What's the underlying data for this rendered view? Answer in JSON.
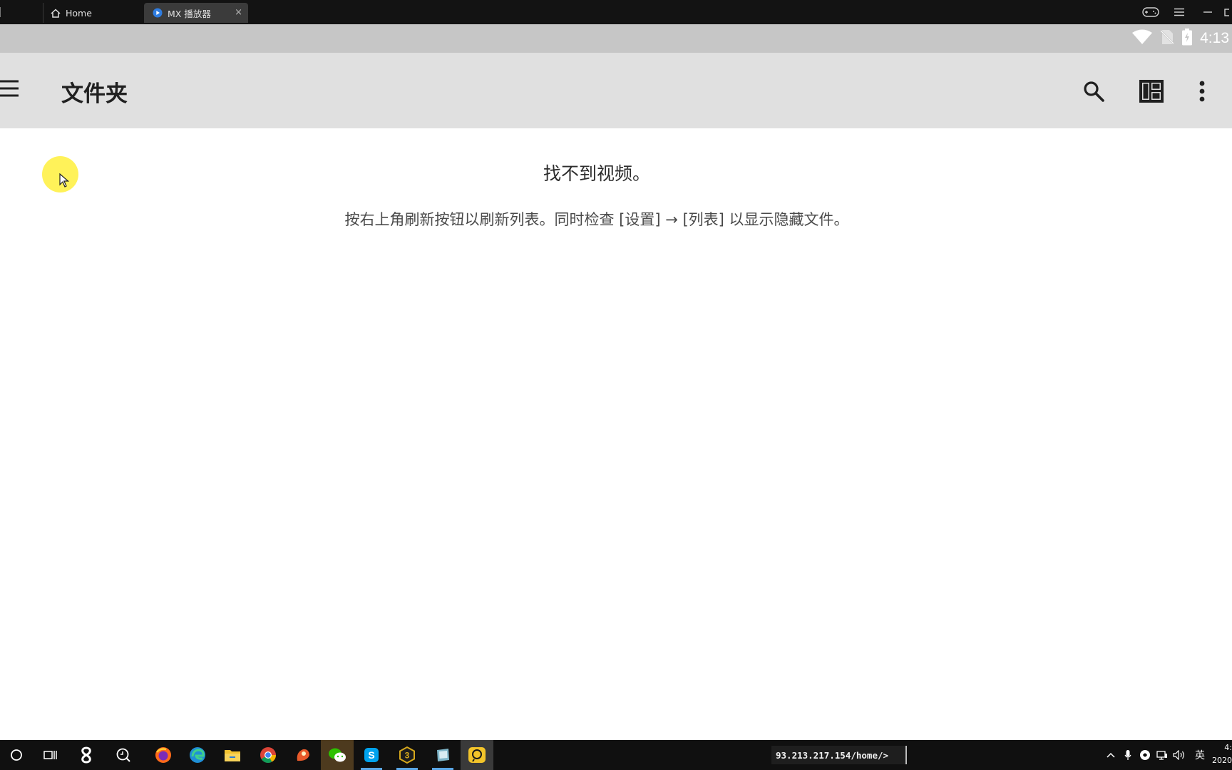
{
  "emulator_bar": {
    "tabs": [
      {
        "label": "Home",
        "icon": "home-icon"
      },
      {
        "label": "MX 播放器",
        "icon": "mx-player-icon",
        "active": true
      }
    ],
    "close_glyph": "×",
    "controls": [
      "gamepad-icon",
      "hamburger-menu-icon",
      "minimize-icon",
      "restore-icon"
    ]
  },
  "status_bar": {
    "icons": [
      "wifi-icon",
      "no-sim-icon",
      "battery-charging-icon"
    ],
    "time": "4:13"
  },
  "app_bar": {
    "title": "文件夹",
    "actions": [
      "search-icon",
      "layout-icon",
      "more-vert-icon"
    ]
  },
  "content": {
    "empty_title": "找不到视频。",
    "empty_hint": "按右上角刷新按钮以刷新列表。同时检查 [设置] → [列表] 以显示隐藏文件。"
  },
  "taskbar": {
    "apps": [
      "start-icon",
      "task-view-icon",
      "app-icon",
      "search-app-icon",
      "firefox-icon",
      "edge-icon",
      "file-explorer-icon",
      "chrome-icon",
      "app-icon",
      "wechat-icon",
      "skype-icon",
      "app-icon",
      "app-icon",
      "app-icon"
    ],
    "command_box": "93.213.217.154/home/>",
    "tray": {
      "language": "英",
      "time": "4:",
      "date": "2020"
    }
  },
  "colors": {
    "title_bar": "#131313",
    "status_bar": "#c6c6c6",
    "app_bar": "#e0e0e0",
    "content_bg": "#ffffff",
    "taskbar": "#101010",
    "cursor_highlight": "#fff03c"
  }
}
